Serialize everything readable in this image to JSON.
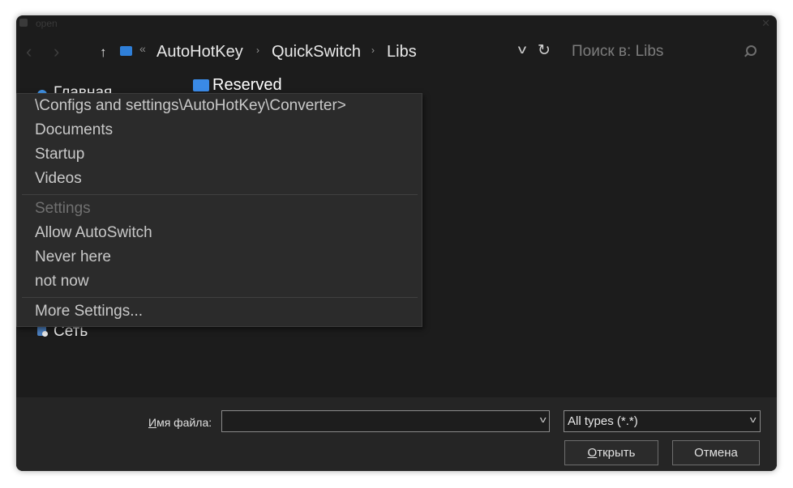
{
  "window": {
    "title": "open",
    "close_glyph": "✕"
  },
  "toolbar": {
    "back_glyph": "‹",
    "forward_glyph": "›",
    "up_glyph": "↑",
    "overflow_glyph": "«",
    "breadcrumbs": [
      "AutoHotKey",
      "QuickSwitch",
      "Libs"
    ],
    "separator_glyph": "›",
    "dropdown_glyph": "v",
    "refresh_glyph": "↻",
    "search_placeholder": "Поиск в: Libs"
  },
  "navigation": {
    "partial_item": "Главная",
    "network_label": "Сеть"
  },
  "files": [
    {
      "name": "Reserved",
      "type": "folder"
    }
  ],
  "context_menu": {
    "favorites": [
      "\\Configs and settings\\AutoHotKey\\Converter>",
      "Documents",
      "Startup",
      "Videos"
    ],
    "settings_header": "Settings",
    "settings_items": [
      "Allow AutoSwitch",
      "Never here",
      "not now"
    ],
    "more_settings": "More Settings..."
  },
  "footer": {
    "filename_label_accel": "И",
    "filename_label_rest": "мя файла:",
    "filename_value": "",
    "filetype_value": "All types (*.*)",
    "open_button_accel": "О",
    "open_button_rest": "ткрыть",
    "cancel_button": "Отмена",
    "chevron_glyph": "v"
  },
  "colors": {
    "window_bg": "#1c1c1c",
    "menu_bg": "#2b2b2b",
    "bottom_bar_bg": "#252525",
    "folder_blue": "#3a8ae6"
  }
}
